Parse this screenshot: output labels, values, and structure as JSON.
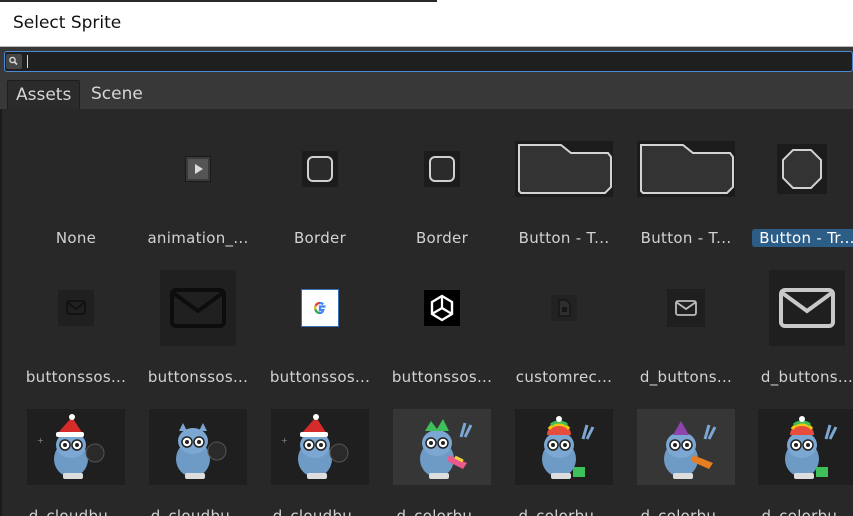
{
  "window": {
    "title": "Select Sprite"
  },
  "search": {
    "placeholder": "",
    "value": ""
  },
  "tabs": [
    {
      "label": "Assets",
      "active": true
    },
    {
      "label": "Scene",
      "active": false
    }
  ],
  "items": [
    {
      "label": "None",
      "icon": "none",
      "selected": false
    },
    {
      "label": "animation_...",
      "icon": "play-icon",
      "selected": false
    },
    {
      "label": "Border",
      "icon": "rounded-square-icon",
      "selected": false
    },
    {
      "label": "Border",
      "icon": "rounded-square-icon",
      "selected": false
    },
    {
      "label": "Button - T...",
      "icon": "folder-tab-icon",
      "selected": false
    },
    {
      "label": "Button - T...",
      "icon": "folder-tab-icon",
      "selected": false
    },
    {
      "label": "Button - Tr...",
      "icon": "octagon-icon",
      "selected": true
    },
    {
      "label": "buttonssos...",
      "icon": "mail-icon",
      "selected": false
    },
    {
      "label": "buttonssos...",
      "icon": "mail-icon",
      "selected": false
    },
    {
      "label": "buttonssos...",
      "icon": "google-icon",
      "selected": false
    },
    {
      "label": "buttonssos...",
      "icon": "unity-icon",
      "selected": false
    },
    {
      "label": "customrec...",
      "icon": "file-icon",
      "selected": false
    },
    {
      "label": "d_buttons...",
      "icon": "mail-icon",
      "selected": false
    },
    {
      "label": "d_buttons...",
      "icon": "mail-icon",
      "selected": false
    },
    {
      "label": "d_cloudbu...",
      "icon": "owl-santa-icon",
      "selected": false
    },
    {
      "label": "d_cloudbu...",
      "icon": "owl-icon",
      "selected": false
    },
    {
      "label": "d_cloudbu...",
      "icon": "owl-santa-icon",
      "selected": false
    },
    {
      "label": "d_colorbu...",
      "icon": "owl-color-icon",
      "selected": false
    },
    {
      "label": "d_colorbu...",
      "icon": "owl-color-icon",
      "selected": false
    },
    {
      "label": "d_colorbu...",
      "icon": "owl-color-icon",
      "selected": false
    },
    {
      "label": "d_colorbu...",
      "icon": "owl-color-icon",
      "selected": false
    }
  ],
  "colors": {
    "accent": "#2c5d87",
    "search_border": "#4a8ad4"
  }
}
